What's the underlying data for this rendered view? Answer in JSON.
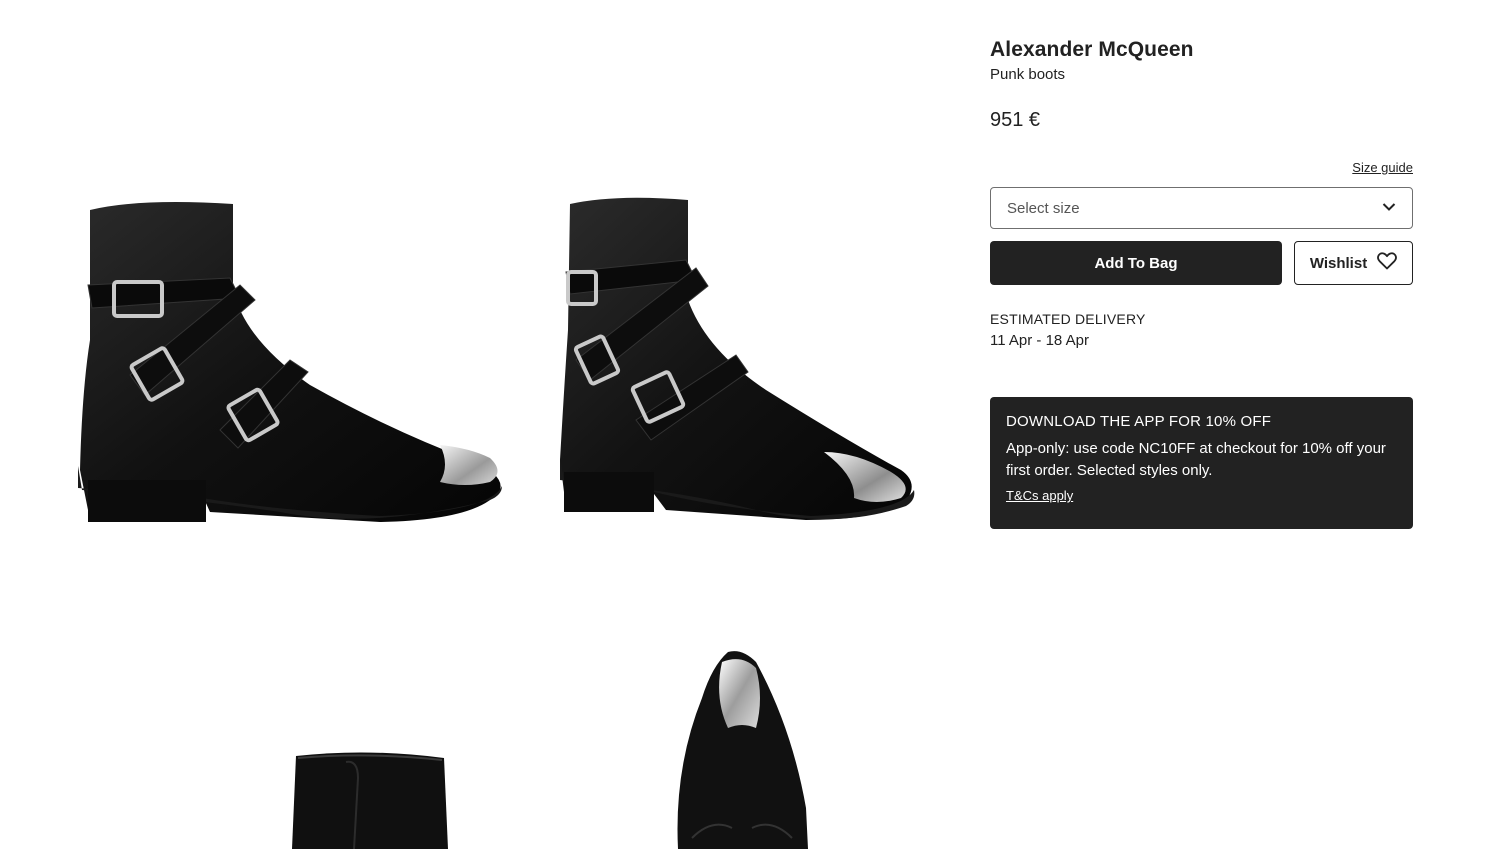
{
  "product": {
    "brand": "Alexander McQueen",
    "name": "Punk boots",
    "price": "951 €"
  },
  "size": {
    "guide_label": "Size guide",
    "select_placeholder": "Select size"
  },
  "actions": {
    "add_to_bag": "Add To Bag",
    "wishlist": "Wishlist"
  },
  "delivery": {
    "title": "ESTIMATED DELIVERY",
    "dates": "11 Apr - 18 Apr"
  },
  "promo": {
    "title": "DOWNLOAD THE APP FOR 10% OFF",
    "body": "App-only: use code NC10FF at checkout for 10% off your first order. Selected styles only.",
    "link": "T&Cs apply"
  },
  "icons": {
    "dropdown": "chevron-down-icon",
    "wishlist": "heart-icon"
  },
  "colors": {
    "primary_dark": "#222222",
    "background": "#ffffff"
  }
}
